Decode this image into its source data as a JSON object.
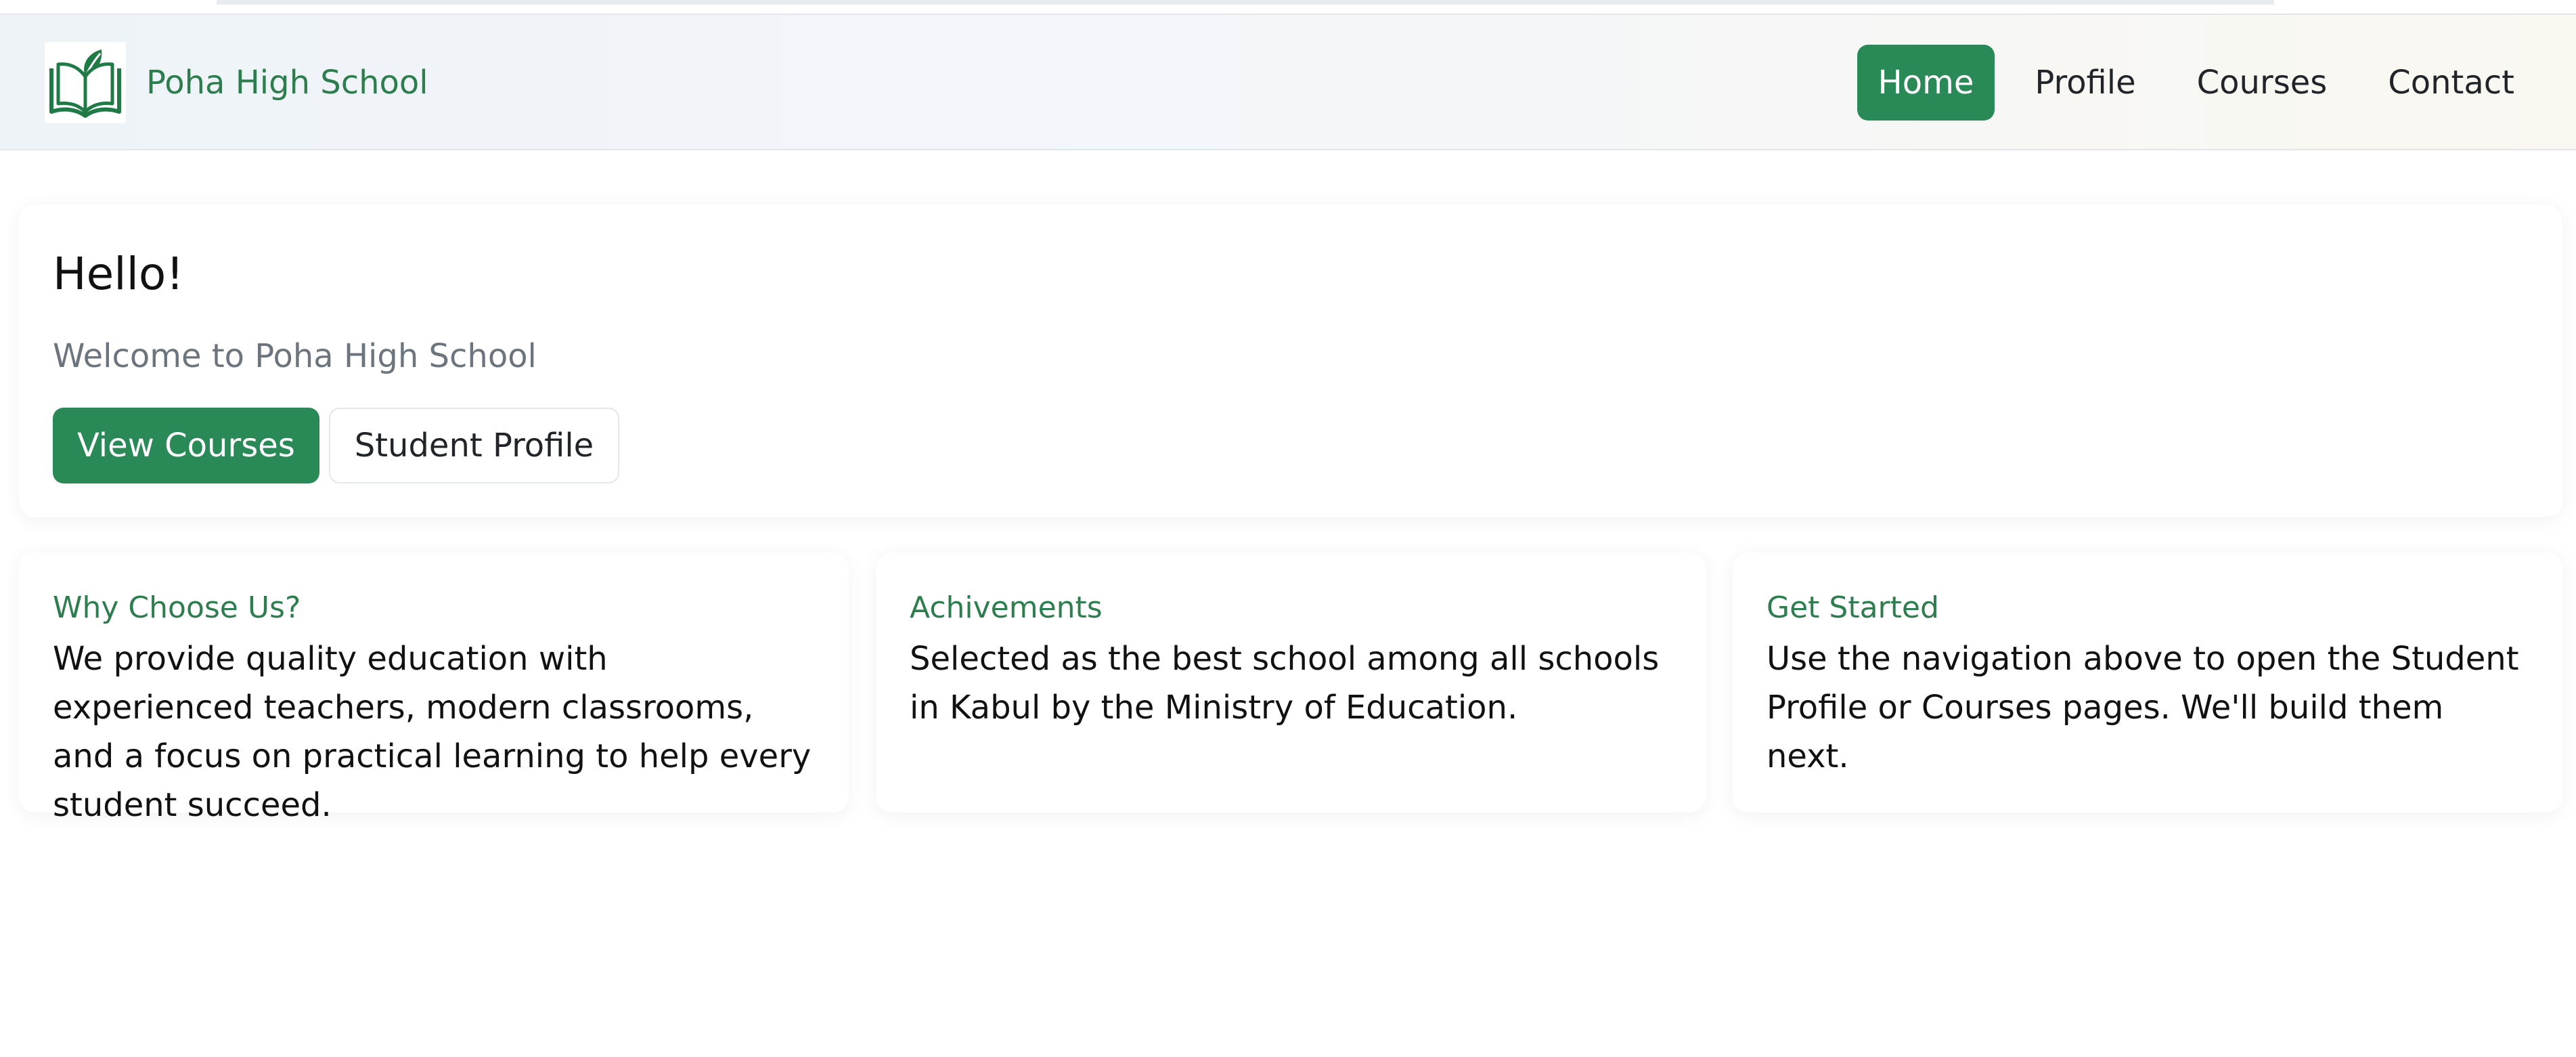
{
  "brand": {
    "name": "Poha High School",
    "accent": "#2a8a57",
    "logo_icon": "open-book-leaf-icon"
  },
  "nav": {
    "items": [
      {
        "label": "Home",
        "active": true
      },
      {
        "label": "Profile",
        "active": false
      },
      {
        "label": "Courses",
        "active": false
      },
      {
        "label": "Contact",
        "active": false
      }
    ]
  },
  "hero": {
    "title": "Hello!",
    "subtitle": "Welcome to Poha High School",
    "primary_button": "View Courses",
    "secondary_button": "Student Profile"
  },
  "cards": [
    {
      "title": "Why Choose Us?",
      "text": "We provide quality education with experienced teachers, modern classrooms, and a focus on practical learning to help every student succeed."
    },
    {
      "title": "Achivements",
      "text": "Selected as the best school among all schools in Kabul by the Ministry of Education."
    },
    {
      "title": "Get Started",
      "text": "Use the navigation above to open the Student Profile or Courses pages. We'll build them next."
    }
  ]
}
